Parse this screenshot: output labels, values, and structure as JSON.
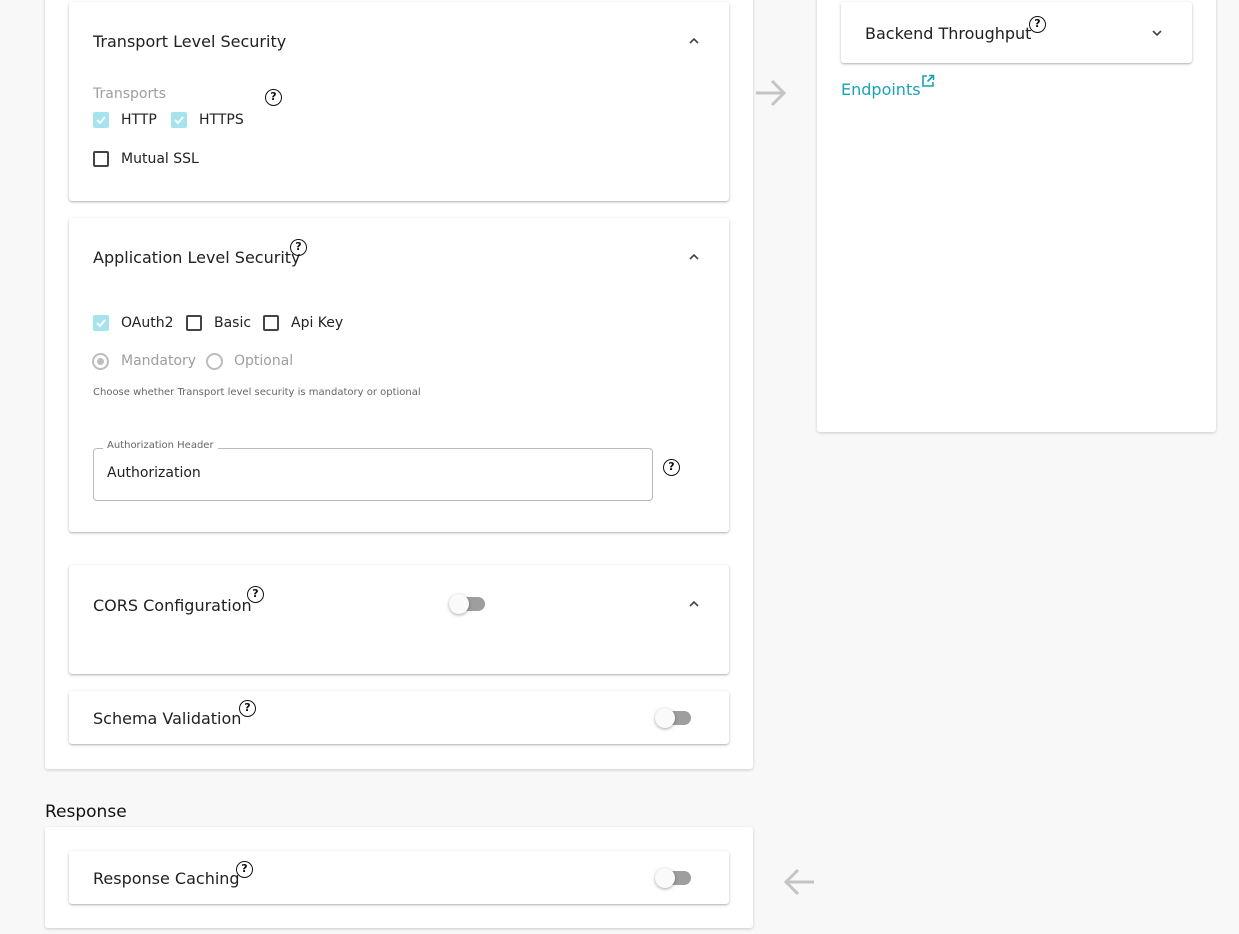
{
  "transport_security": {
    "title": "Transport Level Security",
    "transports_label": "Transports",
    "http_label": "HTTP",
    "http_checked": true,
    "https_label": "HTTPS",
    "https_checked": true,
    "mutual_ssl_label": "Mutual SSL",
    "mutual_ssl_checked": false
  },
  "app_security": {
    "title": "Application Level Security",
    "oauth2_label": "OAuth2",
    "oauth2_checked": true,
    "basic_label": "Basic",
    "basic_checked": false,
    "apikey_label": "Api Key",
    "apikey_checked": false,
    "mandatory_label": "Mandatory",
    "optional_label": "Optional",
    "selected": "Mandatory",
    "helper_text": "Choose whether Transport level security is mandatory or optional",
    "auth_header_label": "Authorization Header",
    "auth_header_value": "Authorization"
  },
  "cors": {
    "title": "CORS Configuration",
    "enabled": false
  },
  "schema_validation": {
    "title": "Schema Validation",
    "enabled": false
  },
  "response": {
    "heading": "Response",
    "caching_title": "Response Caching",
    "caching_enabled": false
  },
  "backend": {
    "throughput_title": "Backend Throughput",
    "endpoints_link": "Endpoints"
  },
  "colors": {
    "accent": "#1aa3b5",
    "checkbox_on": "#a7e3ec",
    "arrow": "#c4c4c4"
  }
}
